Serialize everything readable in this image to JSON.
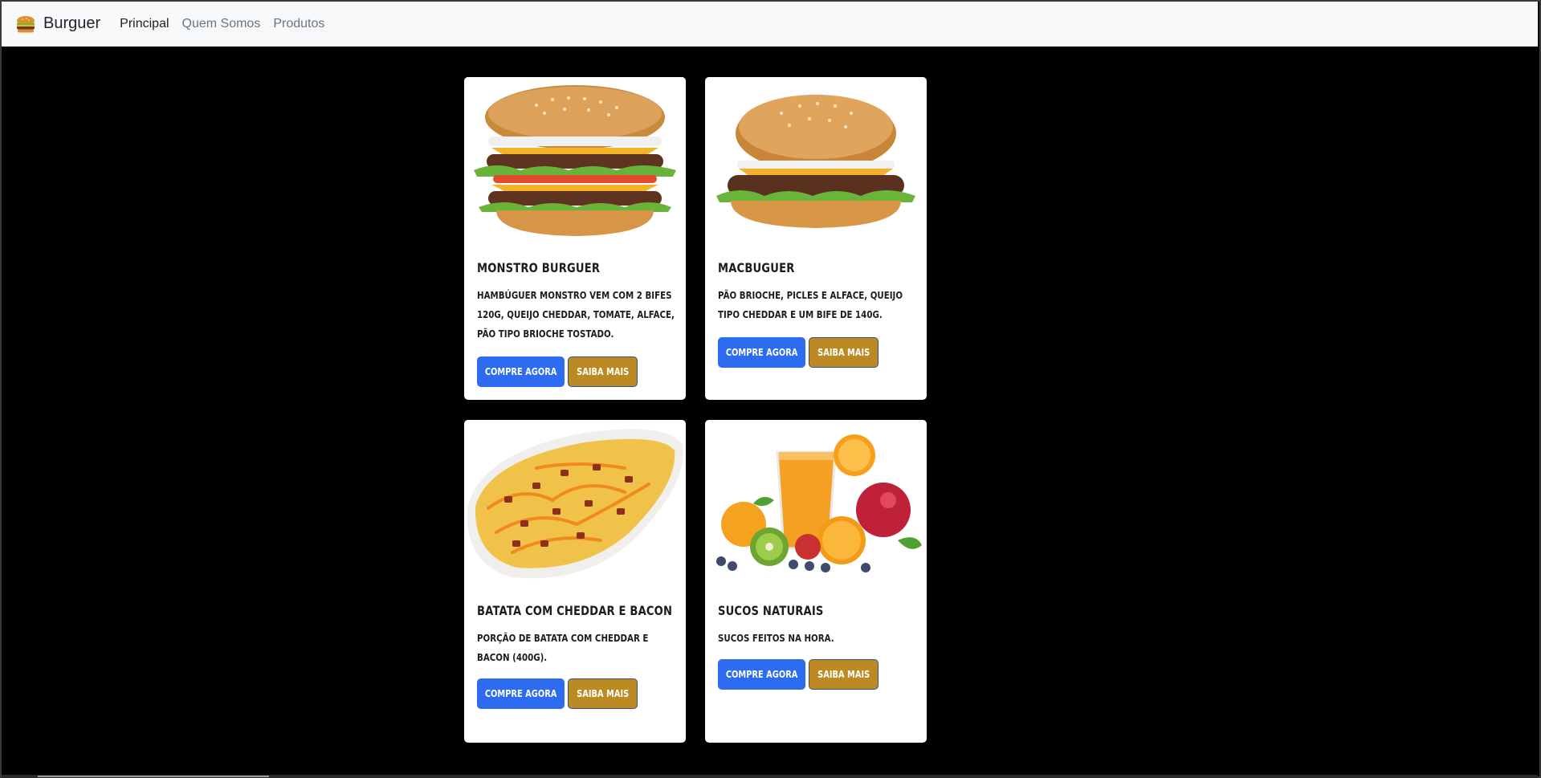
{
  "navbar": {
    "brand": "Burguer",
    "brand_icon": "burger-logo-icon",
    "links": [
      {
        "label": "Principal",
        "active": true
      },
      {
        "label": "Quem Somos",
        "active": false
      },
      {
        "label": "Produtos",
        "active": false
      }
    ]
  },
  "products": [
    {
      "title": "Monstro Burguer",
      "description": "Hambúguer monstro vem com 2 bifes 120g, queijo cheddar, tomate, alface, pão tipo brioche tostado.",
      "image": "double-burger-image",
      "buy_label": "Compre Agora",
      "more_label": "Saiba Mais"
    },
    {
      "title": "MacBuguer",
      "description": "Pão brioche, picles e alface, queijo tipo cheddar e um bife de 140g.",
      "image": "cheeseburger-image",
      "buy_label": "Compre Agora",
      "more_label": "Saiba Mais"
    },
    {
      "title": "Batata com Cheddar e Bacon",
      "description": "Porção de batata com cheddar e bacon (400g).",
      "image": "fries-cheddar-bacon-image",
      "buy_label": "Compre Agora",
      "more_label": "Saiba Mais"
    },
    {
      "title": "Sucos Naturais",
      "description": "Sucos feitos na hora.",
      "image": "orange-juice-fruits-image",
      "buy_label": "Compre Agora",
      "more_label": "Saiba Mais"
    }
  ],
  "colors": {
    "background": "#000000",
    "navbar": "#f8f9fa",
    "buy_button": "#2d6cf0",
    "more_button": "#bb8a22"
  }
}
